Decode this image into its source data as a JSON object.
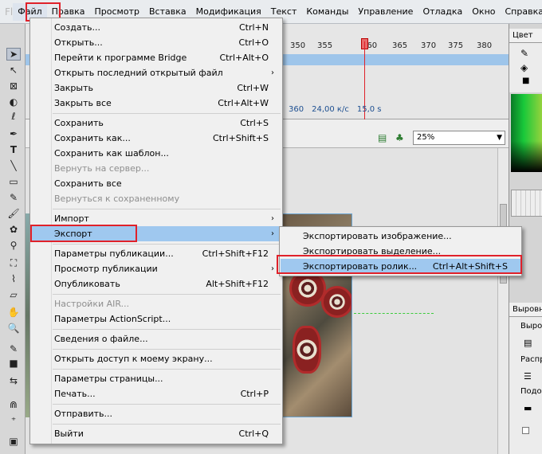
{
  "menubar": {
    "logo": "Fl",
    "items": [
      "Файл",
      "Правка",
      "Просмотр",
      "Вставка",
      "Модификация",
      "Текст",
      "Команды",
      "Управление",
      "Отладка",
      "Окно",
      "Справка"
    ]
  },
  "file_menu": {
    "items": [
      {
        "label": "Создать...",
        "shortcut": "Ctrl+N"
      },
      {
        "label": "Открыть...",
        "shortcut": "Ctrl+O"
      },
      {
        "label": "Перейти к программе Bridge",
        "shortcut": "Ctrl+Alt+O"
      },
      {
        "label": "Открыть последний открытый файл",
        "shortcut": ""
      },
      {
        "label": "Закрыть",
        "shortcut": "Ctrl+W"
      },
      {
        "label": "Закрыть все",
        "shortcut": "Ctrl+Alt+W"
      },
      {
        "label": "Сохранить",
        "shortcut": "Ctrl+S"
      },
      {
        "label": "Сохранить как...",
        "shortcut": "Ctrl+Shift+S"
      },
      {
        "label": "Сохранить как шаблон...",
        "shortcut": ""
      },
      {
        "label": "Вернуть на сервер...",
        "shortcut": ""
      },
      {
        "label": "Сохранить все",
        "shortcut": ""
      },
      {
        "label": "Вернуться к сохраненному",
        "shortcut": ""
      },
      {
        "label": "Импорт",
        "shortcut": ""
      },
      {
        "label": "Экспорт",
        "shortcut": ""
      },
      {
        "label": "Параметры публикации...",
        "shortcut": "Ctrl+Shift+F12"
      },
      {
        "label": "Просмотр публикации",
        "shortcut": ""
      },
      {
        "label": "Опубликовать",
        "shortcut": "Alt+Shift+F12"
      },
      {
        "label": "Настройки AIR...",
        "shortcut": ""
      },
      {
        "label": "Параметры ActionScript...",
        "shortcut": ""
      },
      {
        "label": "Сведения о файле...",
        "shortcut": ""
      },
      {
        "label": "Открыть доступ к моему экрану...",
        "shortcut": ""
      },
      {
        "label": "Параметры страницы...",
        "shortcut": ""
      },
      {
        "label": "Печать...",
        "shortcut": "Ctrl+P"
      },
      {
        "label": "Отправить...",
        "shortcut": ""
      },
      {
        "label": "Выйти",
        "shortcut": "Ctrl+Q"
      }
    ]
  },
  "export_menu": {
    "items": [
      {
        "label": "Экспортировать изображение...",
        "shortcut": ""
      },
      {
        "label": "Экспортировать выделение...",
        "shortcut": ""
      },
      {
        "label": "Экспортировать ролик...",
        "shortcut": "Ctrl+Alt+Shift+S"
      }
    ]
  },
  "timeline": {
    "ruler_ticks": [
      "350",
      "355",
      "360",
      "365",
      "370",
      "375",
      "380"
    ],
    "frame": "360",
    "fps": "24,00",
    "fps_unit": "к/с",
    "time": "15,0",
    "time_unit": "s"
  },
  "editbar": {
    "zoom": "25%"
  },
  "right_panels": {
    "color_tab": "Цвет",
    "align_tab": "Выровн",
    "align_label": "Выров",
    "distribute_label": "Распре",
    "match_label": "Подоб"
  },
  "colors": {
    "highlight": "#9fc8ef",
    "annotation": "#e0212a",
    "menu_bg": "#f0f0f0"
  }
}
